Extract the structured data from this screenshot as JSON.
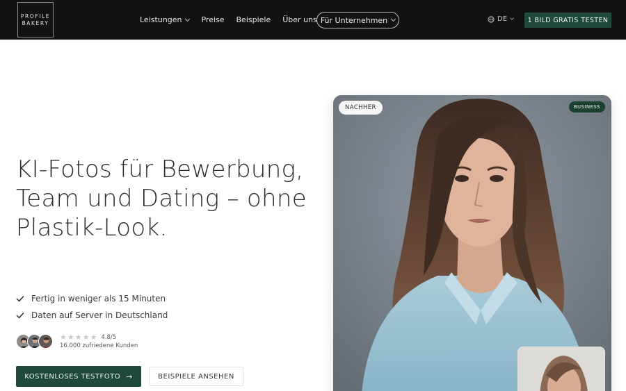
{
  "nav": {
    "logo_line1": "PROFILE",
    "logo_line2": "BAKERY",
    "items": [
      {
        "label": "Leistungen",
        "has_dropdown": true
      },
      {
        "label": "Preise",
        "has_dropdown": false
      },
      {
        "label": "Beispiele",
        "has_dropdown": false
      },
      {
        "label": "Über uns",
        "has_dropdown": false
      }
    ],
    "business_pill": "Für Unternehmen",
    "language": "DE",
    "cta": "1 BILD GRATIS TESTEN"
  },
  "hero": {
    "headline": "KI-Fotos für Bewerbung, Team und Dating – ohne Plastik-Look.",
    "checks": [
      "Fertig in weniger als 15 Minuten",
      "Daten auf Server in Deutschland"
    ],
    "rating": "4.8/5",
    "customers": "16.000 zufriedene Kunden",
    "primary_button": "KOSTENLOSES TESTFOTO",
    "secondary_button": "BEISPIELE ANSEHEN"
  },
  "photo": {
    "badge_after": "NACHHER",
    "badge_category": "BUSINESS"
  },
  "colors": {
    "nav_bg": "#121212",
    "brand_green": "#1f4a3a",
    "photo_bg": "#7a838c"
  },
  "icons": {
    "globe": "globe-icon",
    "check": "check-icon",
    "star": "star-icon",
    "arrow": "arrow-right-icon",
    "chevron": "chevron-down-icon"
  }
}
